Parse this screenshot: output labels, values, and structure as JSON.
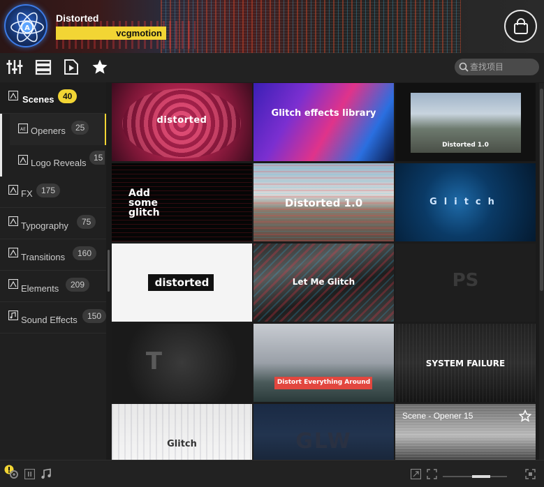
{
  "header": {
    "project_title": "Distorted",
    "author": "vcgmotion",
    "logo_icon": "atom-logo-icon",
    "shop_icon": "shopping-bag-icon"
  },
  "toolbar": {
    "tools": [
      "sliders-icon",
      "list-icon",
      "play-file-icon",
      "star-icon"
    ],
    "search_placeholder": "查找项目"
  },
  "sidebar": {
    "categories": [
      {
        "label": "Scenes",
        "count": "40",
        "icon": "scene-icon",
        "active": true
      },
      {
        "label": "FX",
        "count": "175",
        "icon": "scene-icon"
      },
      {
        "label": "Typography",
        "count": "75",
        "icon": "scene-icon"
      },
      {
        "label": "Transitions",
        "count": "160",
        "icon": "scene-icon"
      },
      {
        "label": "Elements",
        "count": "209",
        "icon": "scene-icon"
      },
      {
        "label": "Sound Effects",
        "count": "150",
        "icon": "sound-file-icon"
      }
    ],
    "subcategories": [
      {
        "label": "Openers",
        "count": "25",
        "icon": "ae-file-icon",
        "selected": true
      },
      {
        "label": "Logo Reveals",
        "count": "15",
        "icon": "scene-icon"
      }
    ]
  },
  "grid": {
    "thumbnails": [
      {
        "text": "distorted"
      },
      {
        "text": "Glitch effects library"
      },
      {
        "text": "Distorted 1.0"
      },
      {
        "text": "Add some glitch"
      },
      {
        "text": "Distorted 1.0"
      },
      {
        "text": "Glitch"
      },
      {
        "text": "distorted"
      },
      {
        "text": "Let Me Glitch"
      },
      {
        "text": "PS"
      },
      {
        "text": "T"
      },
      {
        "text": "Distort Everything Around"
      },
      {
        "text": "SYSTEM FAILURE"
      },
      {
        "text": "Glitch"
      },
      {
        "text": "GLW"
      },
      {
        "text": "",
        "hover_label": "Scene - Opener 15"
      }
    ]
  },
  "bottom": {
    "icons": [
      "warning-icon",
      "settings-icon",
      "pause-icon",
      "music-icon",
      "collapse-icon",
      "fit-icon",
      "fullscreen-icon"
    ],
    "zoom_level": 0.5
  },
  "colors": {
    "accent": "#f2d534",
    "background": "#1b1b1b",
    "sidebar": "#202020"
  }
}
